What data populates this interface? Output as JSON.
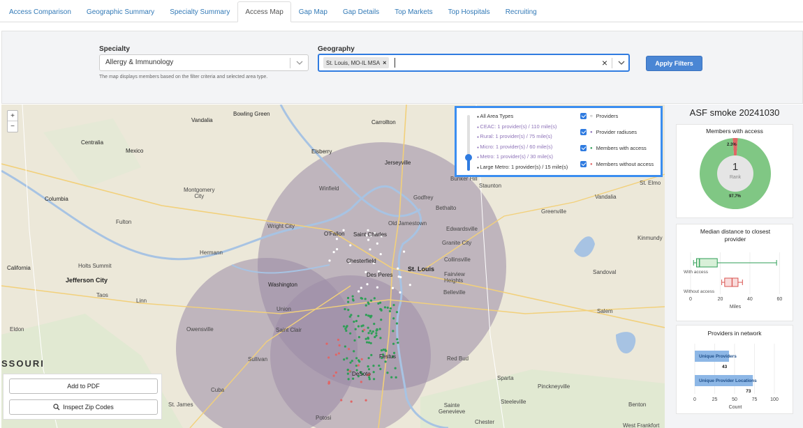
{
  "tabs": [
    {
      "label": "Access Comparison"
    },
    {
      "label": "Geographic Summary"
    },
    {
      "label": "Specialty Summary"
    },
    {
      "label": "Access Map",
      "active": true
    },
    {
      "label": "Gap Map"
    },
    {
      "label": "Gap Details"
    },
    {
      "label": "Top Markets"
    },
    {
      "label": "Top Hospitals"
    },
    {
      "label": "Recruiting"
    }
  ],
  "filters": {
    "specialty_label": "Specialty",
    "specialty_value": "Allergy & Immunology",
    "geography_label": "Geography",
    "geography_chip": "St. Louis, MO-IL MSA",
    "apply_label": "Apply Filters",
    "hint": "The map displays members based on the filter criteria and selected area type."
  },
  "map": {
    "zoom_in": "+",
    "zoom_out": "−",
    "labels": {
      "bowling_green": "Bowling Green",
      "vandalia": "Vandalia",
      "carrollton": "Carrollton",
      "centralia": "Centralia",
      "mexico": "Mexico",
      "elsberry": "Elsberry",
      "jerseyville": "Jerseyville",
      "bunker_hill": "Bunker Hill",
      "staunton": "Staunton",
      "st_elmo": "St. Elmo",
      "columbia": "Columbia",
      "montgomery_city": "Montgomery\nCity",
      "winfield": "Winfield",
      "godfrey": "Godfrey",
      "vandalia_il": "Vandalia",
      "fulton": "Fulton",
      "wright_city": "Wright City",
      "ofallon": "O'Fallon",
      "saint_charles": "Saint Charles",
      "old_jamestown": "Old Jamestown",
      "bethalto": "Bethalto",
      "edwardsville": "Edwardsville",
      "greenville": "Greenville",
      "granite_city": "Granite City",
      "kinmundy": "Kinmundy",
      "california": "California",
      "holts_summit": "Holts Summit",
      "hermann": "Hermann",
      "chesterfield": "Chesterfield",
      "st_louis": "St. Louis",
      "collinsville": "Collinsville",
      "sandoval": "Sandoval",
      "jefferson_city": "Jefferson City",
      "taos": "Taos",
      "washington": "Washington",
      "des_peres": "Des Peres",
      "fairview_heights": "Fairview\nHeights",
      "belleville": "Belleville",
      "linn": "Linn",
      "union": "Union",
      "salem": "Salem",
      "eldon": "Eldon",
      "owensville": "Owensville",
      "saint_clair": "Saint Clair",
      "state_missouri": "SSOURI",
      "sullivan": "Sullivan",
      "festus": "Festus",
      "red_bud": "Red Bud",
      "desoto": "DeSoto",
      "cuba": "Cuba",
      "sparta": "Sparta",
      "pinckneyville": "Pinckneyville",
      "st_james": "St. James",
      "steeleville": "Steeleville",
      "potosi": "Potosi",
      "sainte_genevieve": "Sainte\nGenevieve",
      "benton": "Benton",
      "chester": "Chester",
      "west_frankfort": "West Frankfort"
    }
  },
  "legend": {
    "area_types": [
      {
        "label": "All Area Types",
        "color": "#333333"
      },
      {
        "label": "CEAC: 1 provider(s) / 110 mile(s)",
        "color": "#8e73b8"
      },
      {
        "label": "Rural: 1 provider(s) / 75 mile(s)",
        "color": "#8e73b8"
      },
      {
        "label": "Micro: 1 provider(s) / 60 mile(s)",
        "color": "#8e73b8"
      },
      {
        "label": "Metro: 1 provider(s) / 30 mile(s)",
        "color": "#8e73b8"
      },
      {
        "label": "Large Metro: 1 provider(s) / 15 mile(s)",
        "color": "#333333"
      }
    ],
    "layers": [
      {
        "label": "Providers",
        "dot": "○",
        "dot_color": "#333333",
        "checked": true
      },
      {
        "label": "Provider radiuses",
        "dot": "●",
        "dot_color": "#8e73b8",
        "checked": true
      },
      {
        "label": "Members with access",
        "dot": "●",
        "dot_color": "#2e9e56",
        "checked": true
      },
      {
        "label": "Members without access",
        "dot": "●",
        "dot_color": "#e06666",
        "checked": true
      }
    ]
  },
  "buttons": {
    "add_pdf": "Add to PDF",
    "inspect_zip": "Inspect Zip Codes"
  },
  "right_panel": {
    "title": "ASF smoke 20241030",
    "members_card": {
      "title": "Members with access",
      "center_value": "1",
      "center_label": "Rank",
      "pct_without": "2.3%",
      "pct_with": "97.7%"
    },
    "distance_card": {
      "title": "Median distance to closest provider",
      "xlabel": "Miles",
      "ticks": [
        "0",
        "20",
        "40",
        "60"
      ]
    },
    "providers_card": {
      "title": "Providers in network",
      "xlabel": "Count",
      "ticks": [
        "0",
        "25",
        "50",
        "75",
        "100"
      ]
    }
  },
  "chart_data": [
    {
      "type": "pie",
      "title": "Members with access",
      "categories": [
        "With access",
        "Without access"
      ],
      "values": [
        97.7,
        2.3
      ],
      "colors": [
        "#80c784",
        "#e06666"
      ]
    },
    {
      "type": "box",
      "title": "Median distance to closest provider",
      "xlabel": "Miles",
      "xlim": [
        0,
        65
      ],
      "series": [
        {
          "name": "With access",
          "min": 2,
          "q1": 4,
          "median": 6,
          "q3": 18,
          "max": 58,
          "color": "#2e9e56",
          "fill": "#d8f0d8"
        },
        {
          "name": "Without access",
          "min": 21,
          "q1": 23,
          "median": 28,
          "q3": 32,
          "max": 35,
          "color": "#d9534f",
          "fill": "#f9dcdc"
        }
      ]
    },
    {
      "type": "bar",
      "title": "Providers in network",
      "orientation": "horizontal",
      "xlabel": "Count",
      "xlim": [
        0,
        100
      ],
      "categories": [
        "Unique Providers",
        "Unique Provider Locations"
      ],
      "values": [
        43,
        73
      ],
      "color": "#8db7e6"
    }
  ]
}
